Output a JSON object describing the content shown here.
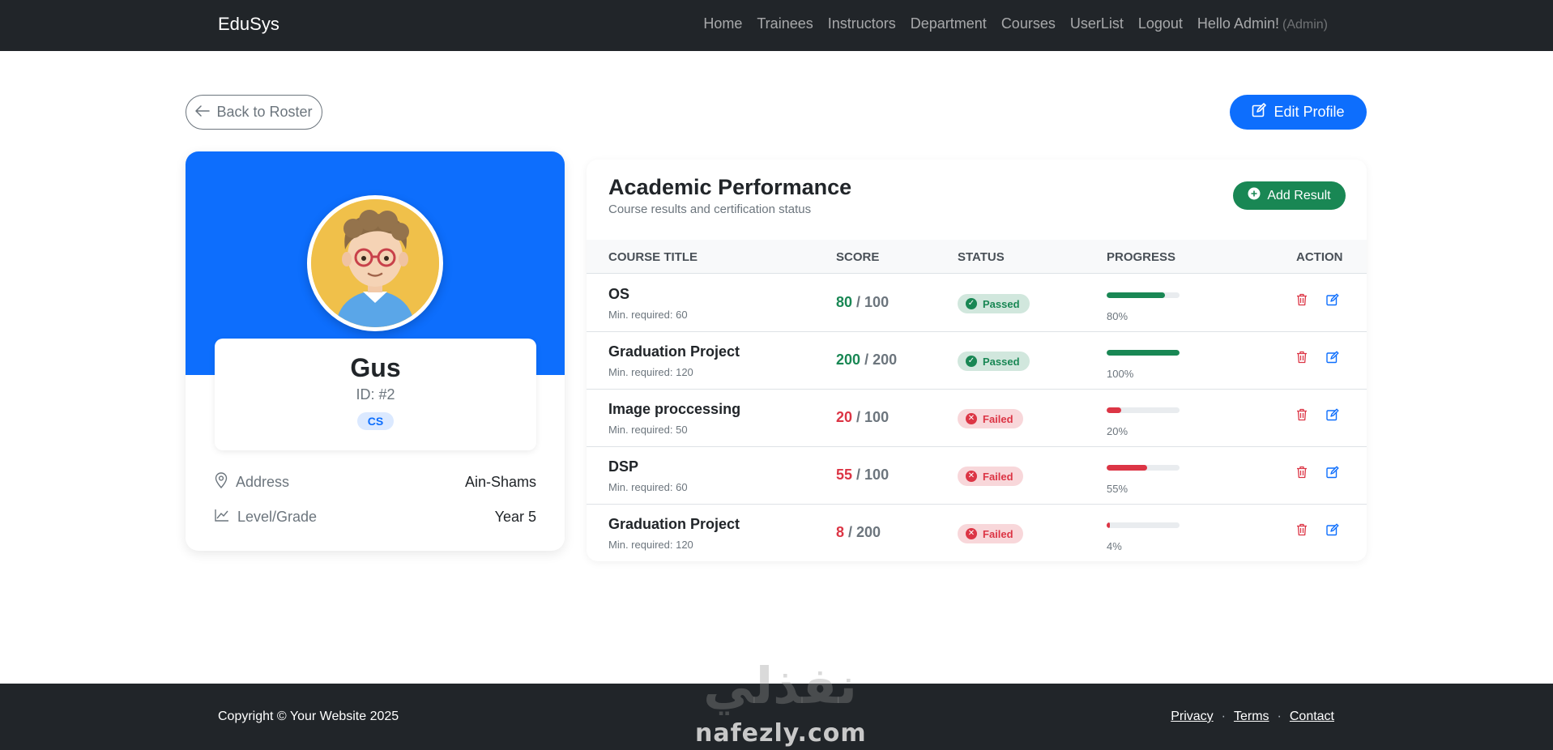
{
  "navbar": {
    "brand": "EduSys",
    "links": [
      "Home",
      "Trainees",
      "Instructors",
      "Department",
      "Courses",
      "UserList",
      "Logout"
    ],
    "greeting": "Hello Admin!",
    "role": "(Admin)"
  },
  "actions": {
    "back_label": "Back to Roster",
    "edit_label": "Edit Profile"
  },
  "profile": {
    "name": "Gus",
    "id_text": "ID: #2",
    "department": "CS",
    "address_label": "Address",
    "address_value": "Ain-Shams",
    "level_label": "Level/Grade",
    "level_value": "Year 5"
  },
  "performance": {
    "title": "Academic Performance",
    "subtitle": "Course results and certification status",
    "add_label": "Add Result",
    "headers": {
      "course": "COURSE TITLE",
      "score": "SCORE",
      "status": "STATUS",
      "progress": "PROGRESS",
      "action": "ACTION"
    },
    "rows": [
      {
        "course": "OS",
        "min": "Min. required: 60",
        "score": "80",
        "max": "/ 100",
        "status": "Passed",
        "passed": true,
        "progress": 80,
        "pct": "80%"
      },
      {
        "course": "Graduation Project",
        "min": "Min. required: 120",
        "score": "200",
        "max": "/ 200",
        "status": "Passed",
        "passed": true,
        "progress": 100,
        "pct": "100%"
      },
      {
        "course": "Image proccessing",
        "min": "Min. required: 50",
        "score": "20",
        "max": "/ 100",
        "status": "Failed",
        "passed": false,
        "progress": 20,
        "pct": "20%"
      },
      {
        "course": "DSP",
        "min": "Min. required: 60",
        "score": "55",
        "max": "/ 100",
        "status": "Failed",
        "passed": false,
        "progress": 55,
        "pct": "55%"
      },
      {
        "course": "Graduation Project",
        "min": "Min. required: 120",
        "score": "8",
        "max": "/ 200",
        "status": "Failed",
        "passed": false,
        "progress": 4,
        "pct": "4%"
      }
    ]
  },
  "footer": {
    "copyright": "Copyright © Your Website 2025",
    "links": [
      "Privacy",
      "Terms",
      "Contact"
    ],
    "separator": "·"
  },
  "watermark": {
    "arabic": "نفذلي",
    "latin": "nafezly.com"
  },
  "colors": {
    "primary": "#0d6efd",
    "success": "#198754",
    "danger": "#dc3545",
    "dark": "#212529"
  },
  "icons": {
    "back": "arrow-left-icon",
    "edit": "pencil-square-icon",
    "add": "plus-circle-icon",
    "address": "geo-alt-icon",
    "level": "graph-up-icon",
    "delete": "trash-icon",
    "edit_row": "edit-icon",
    "passed": "check-circle-icon",
    "failed": "x-circle-icon"
  }
}
